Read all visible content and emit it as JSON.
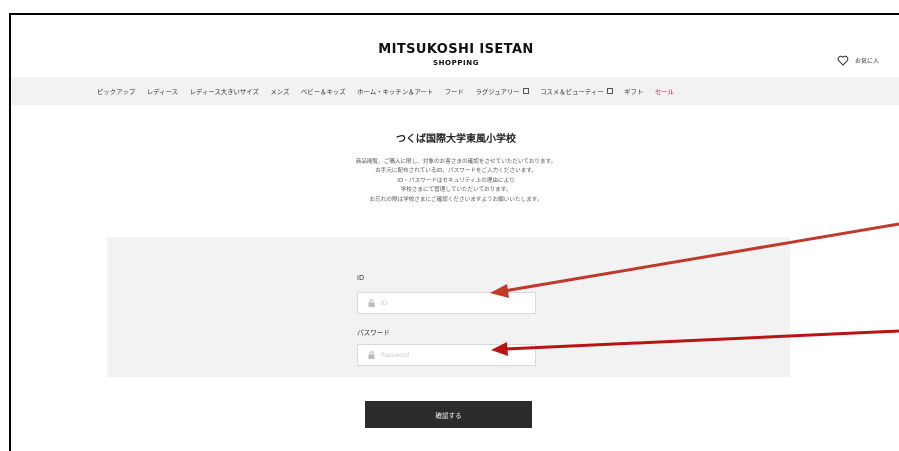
{
  "header": {
    "logo_main": "MITSUKOSHI ISETAN",
    "logo_sub": "SHOPPING",
    "favorites_label": "お気に入",
    "favorites_icon": "heart-icon"
  },
  "nav": {
    "items": [
      {
        "label": "ピックアップ"
      },
      {
        "label": "レディース"
      },
      {
        "label": "レディース大きいサイズ"
      },
      {
        "label": "メンズ"
      },
      {
        "label": "ベビー＆キッズ"
      },
      {
        "label": "ホーム・キッチン＆アート"
      },
      {
        "label": "フード"
      },
      {
        "label": "ラグジュアリー",
        "icon": "external-link-icon"
      },
      {
        "label": "コスメ＆ビューティー",
        "icon": "external-link-icon"
      },
      {
        "label": "ギフト"
      },
      {
        "label": "セール",
        "color": "#c8102e"
      }
    ]
  },
  "main": {
    "title": "つくば国際大学東風小学校",
    "description": [
      "商品閲覧、ご購入に限し、対象のお客さまの確認をさせていただいております。",
      "お手元に配布されているID、パスワードをご入力くださいます。",
      "ID・パスワードはセキュリティ上の理由により",
      "学校さまにて管理していただいております。",
      "お忘れの際は学校さまにご確認くださいますようお願いいたします。"
    ],
    "form": {
      "id_label": "ID",
      "id_placeholder": "ID",
      "id_value": "",
      "password_label": "パスワード",
      "password_placeholder": "Password",
      "password_value": "",
      "field_icon": "lock-icon"
    },
    "confirm_button": "確認する"
  },
  "annotations": {
    "arrow_color": "#c0392b",
    "arrow_icons": [
      "red-arrow-to-id-field",
      "red-arrow-to-password-field"
    ]
  },
  "colors": {
    "nav_background": "#f2f2f2",
    "panel_background": "#f2f2f2",
    "button_background": "#2b2b2b",
    "sale_text": "#c8102e"
  }
}
